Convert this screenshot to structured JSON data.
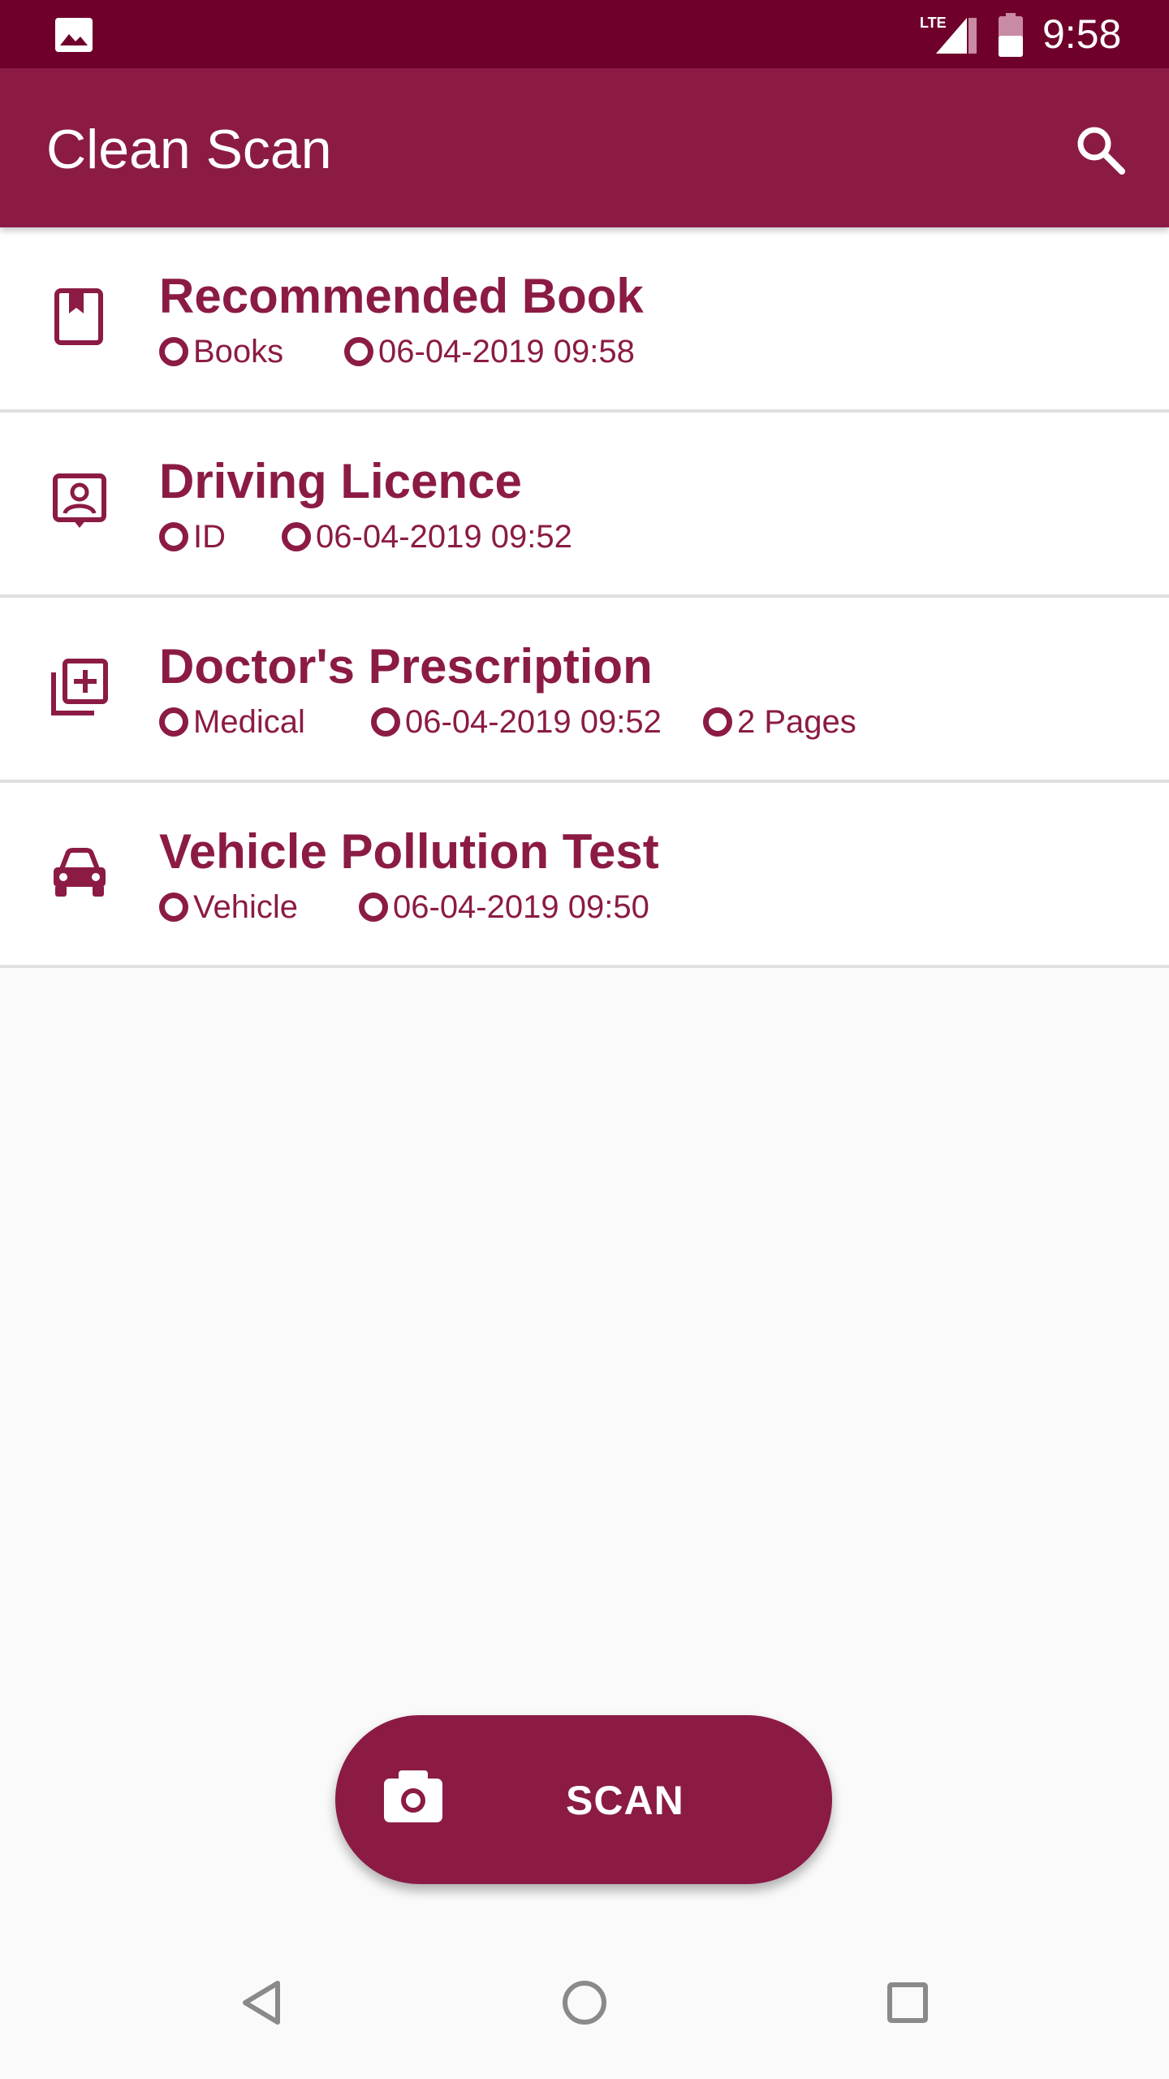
{
  "status_bar": {
    "network": "LTE",
    "time": "9:58",
    "gallery_icon": "image-icon",
    "signal_icon": "signal-icon",
    "battery_icon": "battery-icon"
  },
  "app_bar": {
    "title": "Clean Scan",
    "search_icon": "search-icon"
  },
  "documents": [
    {
      "icon": "book-icon",
      "title": "Recommended Book",
      "category": "Books",
      "timestamp": "06-04-2019 09:58"
    },
    {
      "icon": "contact-id-icon",
      "title": "Driving Licence",
      "category": "ID",
      "timestamp": "06-04-2019 09:52"
    },
    {
      "icon": "medical-add-icon",
      "title": "Doctor's Prescription",
      "category": "Medical",
      "timestamp": "06-04-2019 09:52",
      "pages": "2 Pages"
    },
    {
      "icon": "car-icon",
      "title": "Vehicle Pollution Test",
      "category": "Vehicle",
      "timestamp": "06-04-2019 09:50"
    }
  ],
  "fab": {
    "label": "SCAN",
    "icon": "camera-icon"
  },
  "nav_bar": {
    "back_icon": "back-triangle-icon",
    "home_icon": "home-circle-icon",
    "recents_icon": "recents-square-icon"
  },
  "colors": {
    "status_bar": "#6f002c",
    "primary": "#8b1b45",
    "background": "#fafafa",
    "divider": "#e0e0e0"
  }
}
